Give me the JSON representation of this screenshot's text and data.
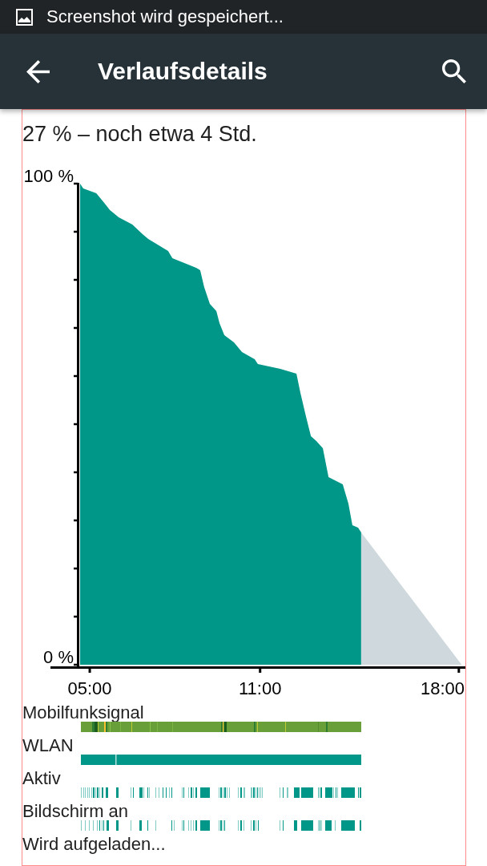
{
  "status_bar": {
    "notification": "Screenshot wird gespeichert..."
  },
  "toolbar": {
    "title": "Verlaufsdetails"
  },
  "summary": "27 % – noch etwa 4 Std.",
  "battery_chart": {
    "chart_data": {
      "type": "area",
      "x": [
        4.66,
        4.77,
        5.23,
        5.51,
        5.71,
        6.02,
        6.5,
        6.86,
        7.06,
        7.76,
        7.91,
        8.75,
        8.89,
        9.03,
        9.23,
        9.46,
        9.57,
        9.74,
        10.08,
        10.36,
        10.81,
        10.92,
        11.71,
        12.28,
        12.42,
        12.62,
        12.79,
        12.98,
        13.21,
        13.41,
        13.91,
        14.11,
        14.25,
        14.45,
        14.56,
        18.1
      ],
      "series": [
        {
          "color": "#009688",
          "values": [
            100,
            99,
            98,
            96,
            94.5,
            93,
            91.5,
            89.5,
            88.5,
            86,
            84.5,
            82.5,
            82,
            78.5,
            75,
            73.5,
            71,
            68.5,
            67,
            65,
            63.5,
            62.5,
            61.5,
            60.5,
            56.5,
            51.5,
            47.5,
            46.5,
            45,
            39,
            37.5,
            33.5,
            29,
            28.5,
            27.5,
            null
          ]
        },
        {
          "color": "#cfd8dc",
          "values": [
            null,
            null,
            null,
            null,
            null,
            null,
            null,
            null,
            null,
            null,
            null,
            null,
            null,
            null,
            null,
            null,
            null,
            null,
            null,
            null,
            null,
            null,
            null,
            null,
            null,
            null,
            null,
            null,
            null,
            null,
            null,
            null,
            null,
            null,
            27.5,
            0
          ]
        }
      ],
      "xlim": [
        4.66,
        18.23
      ],
      "ylim": [
        0,
        100
      ],
      "xticks": [
        {
          "value": 5,
          "label": "05:00"
        },
        {
          "value": 11,
          "label": "11:00"
        },
        {
          "value": 18,
          "label": "18:00"
        }
      ],
      "yticks": [
        {
          "value": 0,
          "label": "0 %"
        },
        {
          "value": 100,
          "label": "100 %"
        }
      ]
    }
  },
  "tracks": [
    {
      "label": "Mobilfunksignal",
      "kind": "signal"
    },
    {
      "label": "WLAN",
      "kind": "wlan"
    },
    {
      "label": "Aktiv",
      "kind": "awake"
    },
    {
      "label": "Bildschirm an",
      "kind": "screen"
    },
    {
      "label": "Wird aufgeladen...",
      "kind": "charging"
    }
  ]
}
